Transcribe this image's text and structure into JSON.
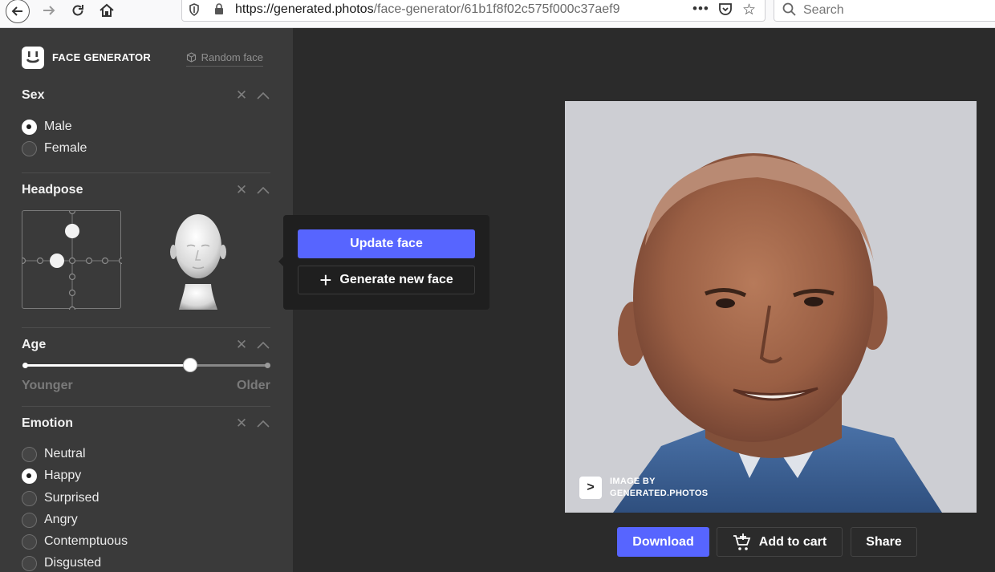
{
  "browser": {
    "url_host": "https://generated.photos",
    "url_path": "/face-generator/61b1f8f02c575f000c37aef9",
    "search_placeholder": "Search",
    "more_label": "•••"
  },
  "sidebar": {
    "brand": "FACE GENERATOR",
    "random_face": "Random face",
    "sex": {
      "title": "Sex",
      "options": [
        {
          "label": "Male",
          "selected": true
        },
        {
          "label": "Female",
          "selected": false
        }
      ]
    },
    "headpose": {
      "title": "Headpose"
    },
    "age": {
      "title": "Age",
      "min_label": "Younger",
      "max_label": "Older",
      "value_fraction": 0.68
    },
    "emotion": {
      "title": "Emotion",
      "options": [
        {
          "label": "Neutral",
          "selected": false
        },
        {
          "label": "Happy",
          "selected": true
        },
        {
          "label": "Surprised",
          "selected": false
        },
        {
          "label": "Angry",
          "selected": false
        },
        {
          "label": "Contemptuous",
          "selected": false
        },
        {
          "label": "Disgusted",
          "selected": false
        }
      ]
    }
  },
  "popover": {
    "update_label": "Update face",
    "generate_label": "Generate new face"
  },
  "photo": {
    "watermark_line1": "IMAGE BY",
    "watermark_line2": "GENERATED.PHOTOS",
    "badge_glyph": ">"
  },
  "actions": {
    "download": "Download",
    "add_to_cart": "Add to cart",
    "share": "Share"
  },
  "colors": {
    "accent": "#5765ff",
    "panel": "#3a3a3a",
    "background": "#2b2b2b"
  }
}
